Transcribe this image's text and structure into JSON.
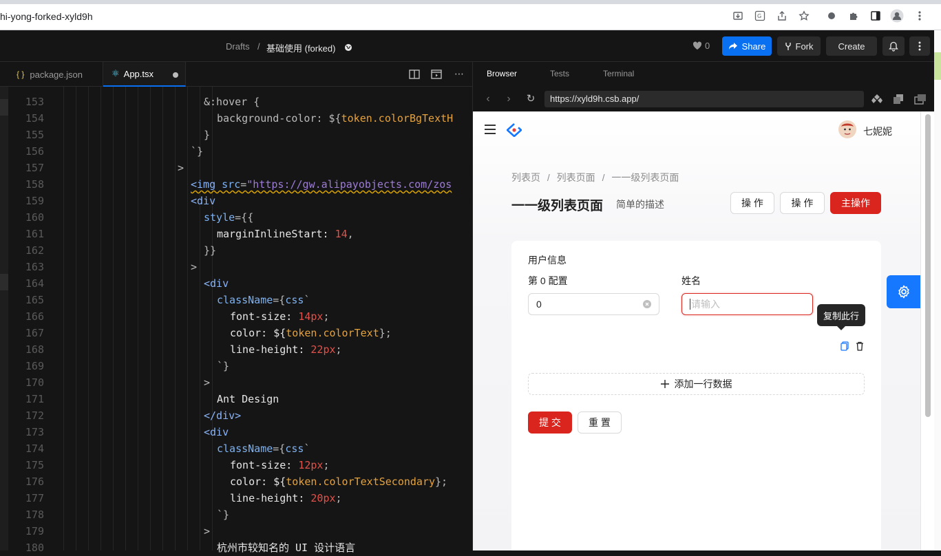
{
  "browser": {
    "url": "hi-yong-forked-xyld9h"
  },
  "header": {
    "crumb_parent": "Drafts",
    "crumb_sep": "/",
    "title": "基础使用 (forked)",
    "likes": "0",
    "share": "Share",
    "fork": "Fork",
    "create": "Create"
  },
  "editor": {
    "tabs": [
      {
        "icon": "{ }",
        "label": "package.json"
      },
      {
        "icon": "⚛",
        "label": "App.tsx"
      }
    ],
    "lines": [
      {
        "n": "153",
        "indent": 2
      },
      {
        "n": "154",
        "indent": 3
      },
      {
        "n": "155",
        "indent": 2
      },
      {
        "n": "156",
        "indent": 1
      },
      {
        "n": "157",
        "indent": 0
      },
      {
        "n": "158",
        "indent": 1
      },
      {
        "n": "159",
        "indent": 1
      },
      {
        "n": "160",
        "indent": 2
      },
      {
        "n": "161",
        "indent": 3
      },
      {
        "n": "162",
        "indent": 2
      },
      {
        "n": "163",
        "indent": 1
      },
      {
        "n": "164",
        "indent": 2
      },
      {
        "n": "165",
        "indent": 3
      },
      {
        "n": "166",
        "indent": 4
      },
      {
        "n": "167",
        "indent": 4
      },
      {
        "n": "168",
        "indent": 4
      },
      {
        "n": "169",
        "indent": 3
      },
      {
        "n": "170",
        "indent": 2
      },
      {
        "n": "171",
        "indent": 3
      },
      {
        "n": "172",
        "indent": 2
      },
      {
        "n": "173",
        "indent": 2
      },
      {
        "n": "174",
        "indent": 3
      },
      {
        "n": "175",
        "indent": 4
      },
      {
        "n": "176",
        "indent": 4
      },
      {
        "n": "177",
        "indent": 4
      },
      {
        "n": "178",
        "indent": 3
      },
      {
        "n": "179",
        "indent": 2
      },
      {
        "n": "180",
        "indent": 3
      }
    ],
    "code": {
      "l153a": "&:hover {",
      "l154a": "background-color: ${",
      "l154b": "token",
      "l154c": ".colorBgTextH",
      "l155a": "}",
      "l156a": "`}",
      "l157a": ">",
      "l158a": "<img",
      "l158b": " src",
      "l158c": "=",
      "l158d": "\"https://gw.alipayobjects.com/zos",
      "l159a": "<div",
      "l160a": "style",
      "l160b": "={{",
      "l161a": "marginInlineStart: ",
      "l161b": "14",
      "l161c": ",",
      "l162a": "}}",
      "l163a": ">",
      "l164a": "<div",
      "l165a": "className",
      "l165b": "={",
      "l165c": "css",
      "l165d": "`",
      "l166a": "font-size: ",
      "l166b": "14px",
      "l166c": ";",
      "l167a": "color: ${",
      "l167b": "token",
      "l167c": ".colorText",
      "l167d": "};",
      "l168a": "line-height: ",
      "l168b": "22px",
      "l168c": ";",
      "l169a": "`}",
      "l170a": ">",
      "l171a": "Ant Design",
      "l172a": "</div>",
      "l173a": "<div",
      "l174a": "className",
      "l174b": "={",
      "l174c": "css",
      "l174d": "`",
      "l175a": "font-size: ",
      "l175b": "12px",
      "l175c": ";",
      "l176a": "color: ${",
      "l176b": "token",
      "l176c": ".colorTextSecondary",
      "l176d": "};",
      "l177a": "line-height: ",
      "l177b": "20px",
      "l177c": ";",
      "l178a": "`}",
      "l179a": ">",
      "l180a": "杭州市较知名的 UI 设计语言"
    }
  },
  "preview": {
    "tabs": [
      "Browser",
      "Tests",
      "Terminal"
    ],
    "address": "https://xyld9h.csb.app/"
  },
  "app": {
    "user_name": "七妮妮",
    "breadcrumb": [
      "列表页",
      "列表页面",
      "一一级列表页面"
    ],
    "breadcrumb_sep": "/",
    "page_title": "一一级列表页面",
    "page_desc": "简单的描述",
    "btn_action1": "操 作",
    "btn_action2": "操 作",
    "btn_primary": "主操作",
    "section_title": "用户信息",
    "field1_label": "第 0 配置",
    "field1_value": "0",
    "field2_label": "姓名",
    "field2_placeholder": "请输入",
    "tooltip": "复制此行",
    "add_row": "添加一行数据",
    "submit": "提 交",
    "reset": "重 置"
  },
  "colors": {
    "accent": "#0971f1",
    "primary_red": "#d9251e",
    "fab_blue": "#1677ff"
  }
}
